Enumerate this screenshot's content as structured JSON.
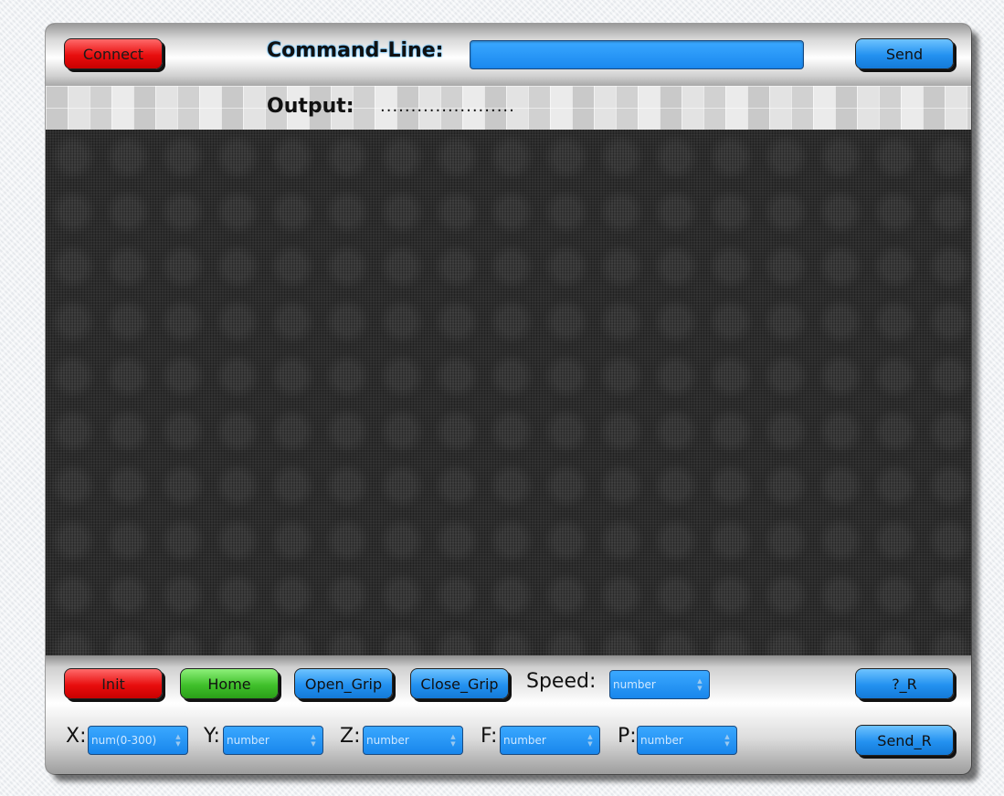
{
  "top": {
    "connect_label": "Connect",
    "command_line_label": "Command-Line:",
    "send_label": "Send"
  },
  "output": {
    "label": "Output:",
    "value": "......................"
  },
  "controls": {
    "init_label": "Init",
    "home_label": "Home",
    "open_grip_label": "Open_Grip",
    "close_grip_label": "Close_Grip",
    "speed_label": "Speed:",
    "speed_placeholder": "number",
    "query_r_label": "?_R",
    "x_label": "X:",
    "x_placeholder": "num(0-300)",
    "y_label": "Y:",
    "y_placeholder": "number",
    "z_label": "Z:",
    "z_placeholder": "number",
    "f_label": "F:",
    "f_placeholder": "number",
    "p_label": "P:",
    "p_placeholder": "number",
    "send_r_label": "Send_R"
  },
  "colors": {
    "red_button": "#e80e0e",
    "green_button": "#40c02b",
    "blue_button": "#2391f0",
    "screen_background": "#2c2c2c"
  },
  "icons": {
    "spinner": "spinner-arrows-icon"
  }
}
